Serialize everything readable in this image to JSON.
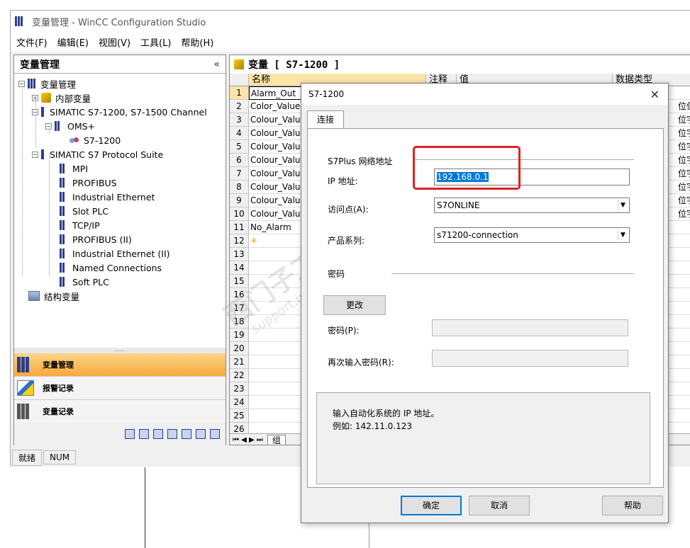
{
  "window": {
    "title": "变量管理 - WinCC Configuration Studio",
    "menu": [
      "文件(F)",
      "编辑(E)",
      "视图(V)",
      "工具(L)",
      "帮助(H)"
    ]
  },
  "left_panel": {
    "title": "变量管理",
    "collapse_glyph": "«",
    "tree": [
      {
        "label": "变量管理",
        "exp": "−"
      },
      {
        "label": "内部变量",
        "exp": "+"
      },
      {
        "label": "SIMATIC S7-1200, S7-1500 Channel",
        "exp": "−"
      },
      {
        "label": "OMS+",
        "exp": "−"
      },
      {
        "label": "S7-1200"
      },
      {
        "label": "SIMATIC S7 Protocol Suite",
        "exp": "−"
      },
      {
        "label": "MPI"
      },
      {
        "label": "PROFIBUS"
      },
      {
        "label": "Industrial Ethernet"
      },
      {
        "label": "Slot PLC"
      },
      {
        "label": "TCP/IP"
      },
      {
        "label": "PROFIBUS (II)"
      },
      {
        "label": "Industrial Ethernet (II)"
      },
      {
        "label": "Named Connections"
      },
      {
        "label": "Soft PLC"
      },
      {
        "label": "结构变量"
      }
    ],
    "nav": [
      "变量管理",
      "报警记录",
      "变量记录"
    ],
    "splitter_glyph": "....."
  },
  "right_panel": {
    "title": "变量 [ S7-1200 ]",
    "columns": [
      "名称",
      "注释",
      "值",
      "数据类型"
    ],
    "rows": [
      "Alarm_Out",
      "Color_Value",
      "Colour_Value",
      "Colour_Value",
      "Colour_Value",
      "Colour_Value",
      "Colour_Value",
      "Colour_Value",
      "Colour_Value",
      "Colour_Value",
      "No_Alarm",
      "",
      "",
      "",
      "",
      "",
      "",
      "",
      "",
      "",
      "",
      "",
      "",
      "",
      "",
      ""
    ],
    "row_numbers": [
      "1",
      "2",
      "3",
      "4",
      "5",
      "6",
      "7",
      "8",
      "9",
      "10",
      "11",
      "12",
      "13",
      "14",
      "15",
      "16",
      "17",
      "18",
      "19",
      "20",
      "21",
      "22",
      "23",
      "24",
      "25",
      "26"
    ],
    "datatype_col": [
      "",
      "位值",
      "位字符",
      "位字符",
      "位字符",
      "位字符",
      "位字符",
      "位字符",
      "位字符",
      "位字符"
    ],
    "sheet_tab": "组",
    "sheet_nav": "⏮ ◀ ▶ ⏭"
  },
  "status_bar": [
    "就绪",
    "NUM"
  ],
  "dialog": {
    "title": "S7-1200",
    "close": "✕",
    "tab": "连接",
    "group_address": "S7Plus 网络地址",
    "ip_label": "IP 地址:",
    "ip_value": "192.168.0.1",
    "access_label": "访问点(A):",
    "access_value": "S7ONLINE",
    "product_label": "产品系列:",
    "product_value": "s71200-connection",
    "group_password": "密码",
    "change_btn": "更改",
    "password_label": "密码(P):",
    "password_repeat_label": "再次输入密码(R):",
    "hint_line1": "输入自动化系统的 IP 地址。",
    "hint_line2": "例如: 142.11.0.123",
    "ok_btn": "确定",
    "cancel_btn": "取消",
    "help_btn": "帮助"
  },
  "watermark": {
    "text1": "西门子工业  找答案",
    "text2": "support.industry.siemens.com/cs"
  },
  "colors": {
    "accent": "#0078d7",
    "highlight": "#e02020",
    "nav_active": "#f7a93a"
  }
}
